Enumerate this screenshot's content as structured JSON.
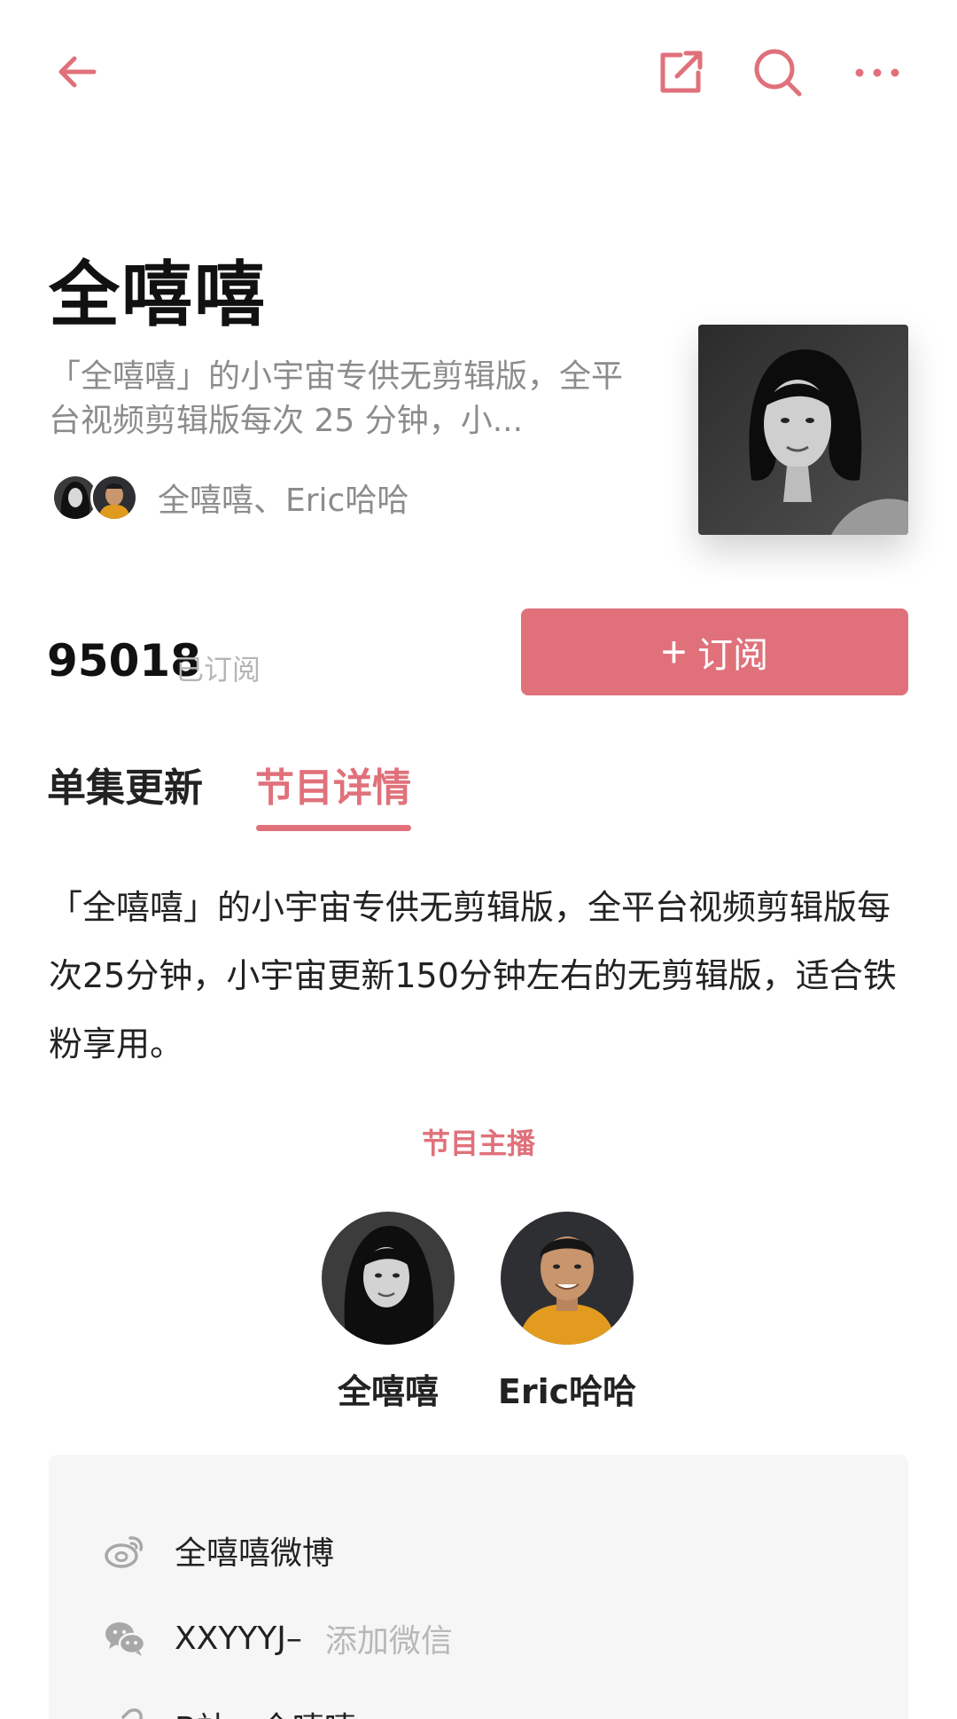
{
  "header": {
    "title": "全嘻嘻",
    "summary": "「全嘻嘻」的小宇宙专供无剪辑版，全平台视频剪辑版每次 25 分钟，小...",
    "host_names": "全嘻嘻、Eric哈哈"
  },
  "icons": {
    "back": "arrow-left-icon",
    "share": "share-external-icon",
    "search": "search-icon",
    "more": "more-dots-icon",
    "weibo": "weibo-icon",
    "wechat": "wechat-icon",
    "link": "link-icon"
  },
  "subscribe": {
    "count": "95018",
    "count_label": "已订阅",
    "button_label": "订阅",
    "button_plus": "+"
  },
  "tabs": [
    {
      "label": "单集更新",
      "active": false
    },
    {
      "label": "节目详情",
      "active": true
    }
  ],
  "description": "「全嘻嘻」的小宇宙专供无剪辑版，全平台视频剪辑版每次25分钟，小宇宙更新150分钟左右的无剪辑版，适合铁粉享用。",
  "hosts": {
    "heading": "节目主播",
    "items": [
      {
        "name": "全嘻嘻"
      },
      {
        "name": "Eric哈哈"
      }
    ]
  },
  "contacts": {
    "weibo_label": "全嘻嘻微博",
    "wechat_id": "XXYYYJ–",
    "wechat_action": "添加微信",
    "bilibili_label": "B站：全嘻嘻"
  },
  "colors": {
    "accent": "#e0717b",
    "text": "#222222",
    "muted": "#8c8c8c",
    "panel": "#f6f6f6"
  }
}
